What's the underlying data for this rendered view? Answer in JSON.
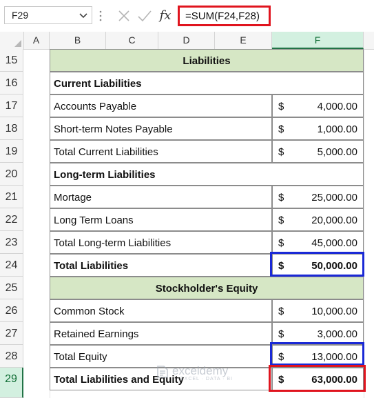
{
  "formula_bar": {
    "name_box": "F29",
    "fx_label": "fx",
    "formula": "=SUM(F24,F28)"
  },
  "columns": [
    "A",
    "B",
    "C",
    "D",
    "E",
    "F"
  ],
  "rows": [
    "15",
    "16",
    "17",
    "18",
    "19",
    "20",
    "21",
    "22",
    "23",
    "24",
    "25",
    "26",
    "27",
    "28",
    "29"
  ],
  "selected": {
    "column": "F",
    "row": "29"
  },
  "sheet": {
    "liabilities_header": "Liabilities",
    "current_liabilities": "Current Liabilities",
    "accounts_payable": {
      "label": "Accounts Payable",
      "currency": "$",
      "value": "4,000.00"
    },
    "short_term_notes": {
      "label": "Short-term Notes Payable",
      "currency": "$",
      "value": "1,000.00"
    },
    "total_current": {
      "label": "Total Current Liabilities",
      "currency": "$",
      "value": "5,000.00"
    },
    "long_term_liabilities": "Long-term Liabilities",
    "mortage": {
      "label": "Mortage",
      "currency": "$",
      "value": "25,000.00"
    },
    "long_term_loans": {
      "label": "Long Term Loans",
      "currency": "$",
      "value": "20,000.00"
    },
    "total_long_term": {
      "label": "Total Long-term Liabilities",
      "currency": "$",
      "value": "45,000.00"
    },
    "total_liabilities": {
      "label": "Total Liabilities",
      "currency": "$",
      "value": "50,000.00"
    },
    "equity_header": "Stockholder's Equity",
    "common_stock": {
      "label": "Common Stock",
      "currency": "$",
      "value": "10,000.00"
    },
    "retained_earnings": {
      "label": "Retained Earnings",
      "currency": "$",
      "value": "3,000.00"
    },
    "total_equity": {
      "label": "Total Equity",
      "currency": "$",
      "value": "13,000.00"
    },
    "total_liab_equity": {
      "label": "Total Liabilities and Equity",
      "currency": "$",
      "value": "63,000.00"
    }
  },
  "watermark": {
    "name": "exceldemy",
    "tagline": "EXCEL · DATA · BI"
  },
  "colors": {
    "header_band": "#d6e7c5",
    "highlight_blue": "#1a29d6",
    "highlight_red": "#e0141e",
    "selection": "#217346"
  }
}
